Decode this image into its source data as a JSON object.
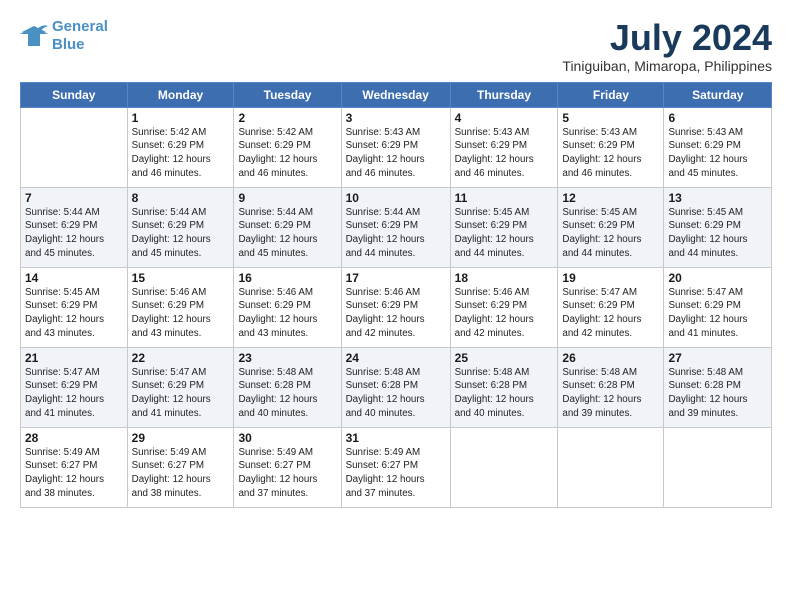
{
  "logo": {
    "line1": "General",
    "line2": "Blue"
  },
  "title": "July 2024",
  "subtitle": "Tiniguiban, Mimaropa, Philippines",
  "weekdays": [
    "Sunday",
    "Monday",
    "Tuesday",
    "Wednesday",
    "Thursday",
    "Friday",
    "Saturday"
  ],
  "weeks": [
    [
      {
        "day": "",
        "info": ""
      },
      {
        "day": "1",
        "info": "Sunrise: 5:42 AM\nSunset: 6:29 PM\nDaylight: 12 hours\nand 46 minutes."
      },
      {
        "day": "2",
        "info": "Sunrise: 5:42 AM\nSunset: 6:29 PM\nDaylight: 12 hours\nand 46 minutes."
      },
      {
        "day": "3",
        "info": "Sunrise: 5:43 AM\nSunset: 6:29 PM\nDaylight: 12 hours\nand 46 minutes."
      },
      {
        "day": "4",
        "info": "Sunrise: 5:43 AM\nSunset: 6:29 PM\nDaylight: 12 hours\nand 46 minutes."
      },
      {
        "day": "5",
        "info": "Sunrise: 5:43 AM\nSunset: 6:29 PM\nDaylight: 12 hours\nand 46 minutes."
      },
      {
        "day": "6",
        "info": "Sunrise: 5:43 AM\nSunset: 6:29 PM\nDaylight: 12 hours\nand 45 minutes."
      }
    ],
    [
      {
        "day": "7",
        "info": "Sunrise: 5:44 AM\nSunset: 6:29 PM\nDaylight: 12 hours\nand 45 minutes."
      },
      {
        "day": "8",
        "info": "Sunrise: 5:44 AM\nSunset: 6:29 PM\nDaylight: 12 hours\nand 45 minutes."
      },
      {
        "day": "9",
        "info": "Sunrise: 5:44 AM\nSunset: 6:29 PM\nDaylight: 12 hours\nand 45 minutes."
      },
      {
        "day": "10",
        "info": "Sunrise: 5:44 AM\nSunset: 6:29 PM\nDaylight: 12 hours\nand 44 minutes."
      },
      {
        "day": "11",
        "info": "Sunrise: 5:45 AM\nSunset: 6:29 PM\nDaylight: 12 hours\nand 44 minutes."
      },
      {
        "day": "12",
        "info": "Sunrise: 5:45 AM\nSunset: 6:29 PM\nDaylight: 12 hours\nand 44 minutes."
      },
      {
        "day": "13",
        "info": "Sunrise: 5:45 AM\nSunset: 6:29 PM\nDaylight: 12 hours\nand 44 minutes."
      }
    ],
    [
      {
        "day": "14",
        "info": "Sunrise: 5:45 AM\nSunset: 6:29 PM\nDaylight: 12 hours\nand 43 minutes."
      },
      {
        "day": "15",
        "info": "Sunrise: 5:46 AM\nSunset: 6:29 PM\nDaylight: 12 hours\nand 43 minutes."
      },
      {
        "day": "16",
        "info": "Sunrise: 5:46 AM\nSunset: 6:29 PM\nDaylight: 12 hours\nand 43 minutes."
      },
      {
        "day": "17",
        "info": "Sunrise: 5:46 AM\nSunset: 6:29 PM\nDaylight: 12 hours\nand 42 minutes."
      },
      {
        "day": "18",
        "info": "Sunrise: 5:46 AM\nSunset: 6:29 PM\nDaylight: 12 hours\nand 42 minutes."
      },
      {
        "day": "19",
        "info": "Sunrise: 5:47 AM\nSunset: 6:29 PM\nDaylight: 12 hours\nand 42 minutes."
      },
      {
        "day": "20",
        "info": "Sunrise: 5:47 AM\nSunset: 6:29 PM\nDaylight: 12 hours\nand 41 minutes."
      }
    ],
    [
      {
        "day": "21",
        "info": "Sunrise: 5:47 AM\nSunset: 6:29 PM\nDaylight: 12 hours\nand 41 minutes."
      },
      {
        "day": "22",
        "info": "Sunrise: 5:47 AM\nSunset: 6:29 PM\nDaylight: 12 hours\nand 41 minutes."
      },
      {
        "day": "23",
        "info": "Sunrise: 5:48 AM\nSunset: 6:28 PM\nDaylight: 12 hours\nand 40 minutes."
      },
      {
        "day": "24",
        "info": "Sunrise: 5:48 AM\nSunset: 6:28 PM\nDaylight: 12 hours\nand 40 minutes."
      },
      {
        "day": "25",
        "info": "Sunrise: 5:48 AM\nSunset: 6:28 PM\nDaylight: 12 hours\nand 40 minutes."
      },
      {
        "day": "26",
        "info": "Sunrise: 5:48 AM\nSunset: 6:28 PM\nDaylight: 12 hours\nand 39 minutes."
      },
      {
        "day": "27",
        "info": "Sunrise: 5:48 AM\nSunset: 6:28 PM\nDaylight: 12 hours\nand 39 minutes."
      }
    ],
    [
      {
        "day": "28",
        "info": "Sunrise: 5:49 AM\nSunset: 6:27 PM\nDaylight: 12 hours\nand 38 minutes."
      },
      {
        "day": "29",
        "info": "Sunrise: 5:49 AM\nSunset: 6:27 PM\nDaylight: 12 hours\nand 38 minutes."
      },
      {
        "day": "30",
        "info": "Sunrise: 5:49 AM\nSunset: 6:27 PM\nDaylight: 12 hours\nand 37 minutes."
      },
      {
        "day": "31",
        "info": "Sunrise: 5:49 AM\nSunset: 6:27 PM\nDaylight: 12 hours\nand 37 minutes."
      },
      {
        "day": "",
        "info": ""
      },
      {
        "day": "",
        "info": ""
      },
      {
        "day": "",
        "info": ""
      }
    ]
  ]
}
